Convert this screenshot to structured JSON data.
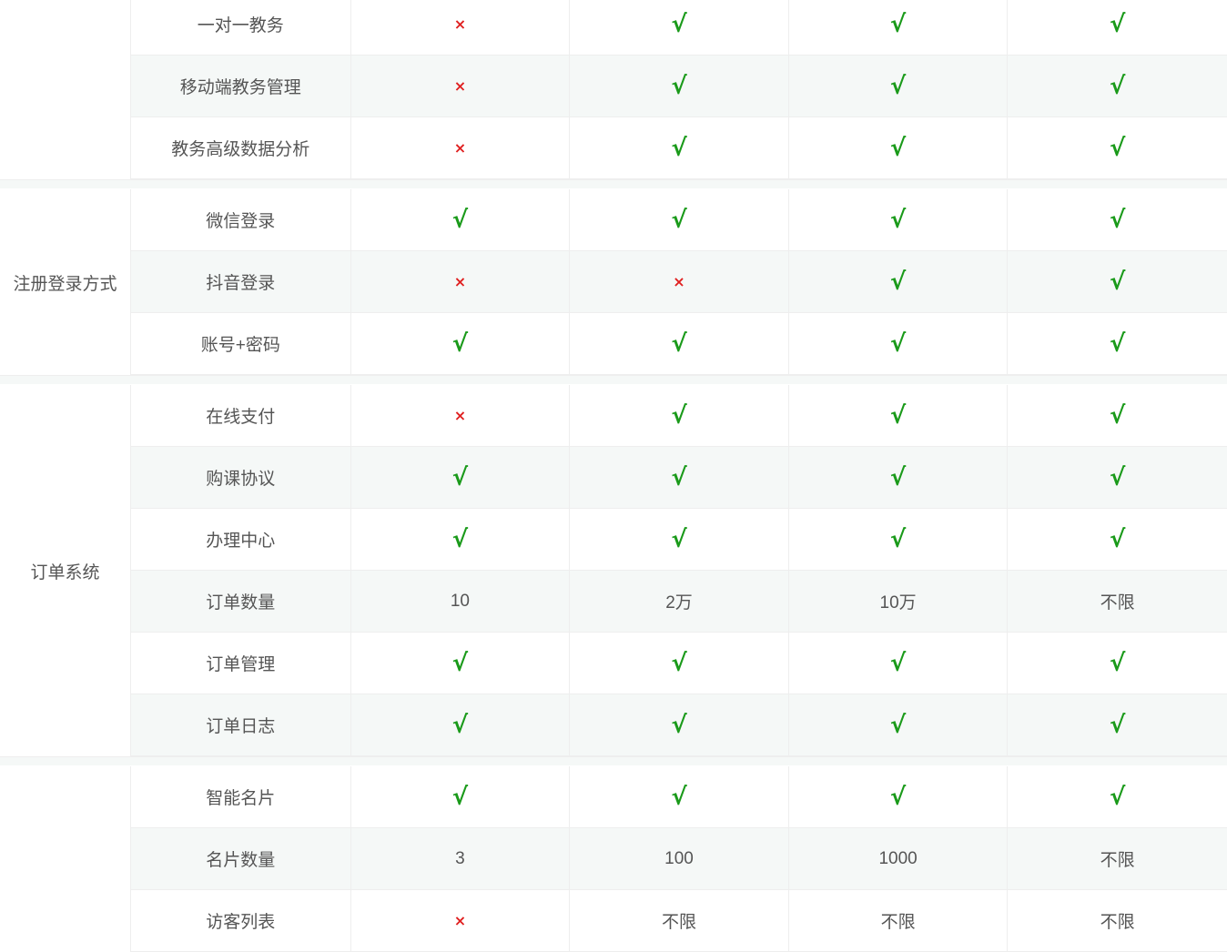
{
  "check_glyph": "√",
  "cross_glyph": "×",
  "colors": {
    "check": "#1a9a1a",
    "cross": "#e02020",
    "stripe": "#f5f8f7"
  },
  "groups": [
    {
      "label": "",
      "rows": [
        {
          "feature": "一对一教务",
          "values": [
            "x",
            "v",
            "v",
            "v"
          ]
        },
        {
          "feature": "移动端教务管理",
          "values": [
            "x",
            "v",
            "v",
            "v"
          ]
        },
        {
          "feature": "教务高级数据分析",
          "values": [
            "x",
            "v",
            "v",
            "v"
          ]
        }
      ]
    },
    {
      "label": "注册登录方式",
      "rows": [
        {
          "feature": "微信登录",
          "values": [
            "v",
            "v",
            "v",
            "v"
          ]
        },
        {
          "feature": "抖音登录",
          "values": [
            "x",
            "x",
            "v",
            "v"
          ]
        },
        {
          "feature": "账号+密码",
          "values": [
            "v",
            "v",
            "v",
            "v"
          ]
        }
      ]
    },
    {
      "label": "订单系统",
      "rows": [
        {
          "feature": "在线支付",
          "values": [
            "x",
            "v",
            "v",
            "v"
          ]
        },
        {
          "feature": "购课协议",
          "values": [
            "v",
            "v",
            "v",
            "v"
          ]
        },
        {
          "feature": "办理中心",
          "values": [
            "v",
            "v",
            "v",
            "v"
          ]
        },
        {
          "feature": "订单数量",
          "values": [
            "10",
            "2万",
            "10万",
            "不限"
          ]
        },
        {
          "feature": "订单管理",
          "values": [
            "v",
            "v",
            "v",
            "v"
          ]
        },
        {
          "feature": "订单日志",
          "values": [
            "v",
            "v",
            "v",
            "v"
          ]
        }
      ]
    },
    {
      "label": "",
      "rows": [
        {
          "feature": "智能名片",
          "values": [
            "v",
            "v",
            "v",
            "v"
          ]
        },
        {
          "feature": "名片数量",
          "values": [
            "3",
            "100",
            "1000",
            "不限"
          ]
        },
        {
          "feature": "访客列表",
          "values": [
            "x",
            "不限",
            "不限",
            "不限"
          ]
        }
      ]
    }
  ]
}
